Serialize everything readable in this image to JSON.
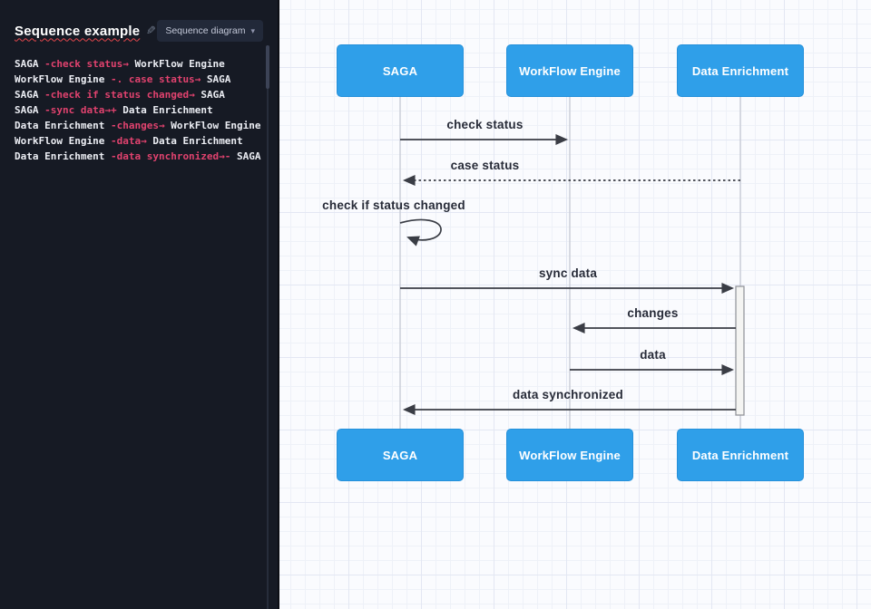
{
  "editor": {
    "title": "Sequence example",
    "diagram_type_label": "Sequence diagram",
    "code_lines": [
      {
        "pre": "SAGA ",
        "accent": "-check status→",
        "post": " WorkFlow Engine"
      },
      {
        "pre": "WorkFlow Engine ",
        "accent": "-. case status→",
        "post": " SAGA"
      },
      {
        "pre": "SAGA ",
        "accent": "-check if status changed→",
        "post": " SAGA"
      },
      {
        "pre": "SAGA ",
        "accent": "-sync data→+",
        "post": " Data Enrichment"
      },
      {
        "pre": "Data Enrichment ",
        "accent": "-changes→",
        "post": " WorkFlow Engine"
      },
      {
        "pre": "WorkFlow Engine ",
        "accent": "-data→",
        "post": " Data Enrichment"
      },
      {
        "pre": "Data Enrichment ",
        "accent": "-data synchronized→-",
        "post": " SAGA"
      }
    ]
  },
  "diagram": {
    "actors": [
      "SAGA",
      "WorkFlow Engine",
      "Data Enrichment"
    ],
    "messages": [
      {
        "label": "check status",
        "from": "SAGA",
        "to": "WorkFlow Engine",
        "style": "solid"
      },
      {
        "label": "case status",
        "from": "WorkFlow Engine",
        "to": "SAGA",
        "style": "dotted"
      },
      {
        "label": "check if status changed",
        "from": "SAGA",
        "to": "SAGA",
        "style": "self"
      },
      {
        "label": "sync data",
        "from": "SAGA",
        "to": "Data Enrichment",
        "style": "solid",
        "activates": true
      },
      {
        "label": "changes",
        "from": "Data Enrichment",
        "to": "WorkFlow Engine",
        "style": "solid"
      },
      {
        "label": "data",
        "from": "WorkFlow Engine",
        "to": "Data Enrichment",
        "style": "solid"
      },
      {
        "label": "data synchronized",
        "from": "Data Enrichment",
        "to": "SAGA",
        "style": "solid",
        "deactivates": true
      }
    ]
  },
  "colors": {
    "panel_bg": "#161a24",
    "code_accent": "#e0426e",
    "code_text": "#eceef4",
    "actor_blue": "#2f9fe9",
    "spellcheck_underline": "#e5484d",
    "arrow": "#3a3d45",
    "canvas_bg": "#fafbfe"
  }
}
